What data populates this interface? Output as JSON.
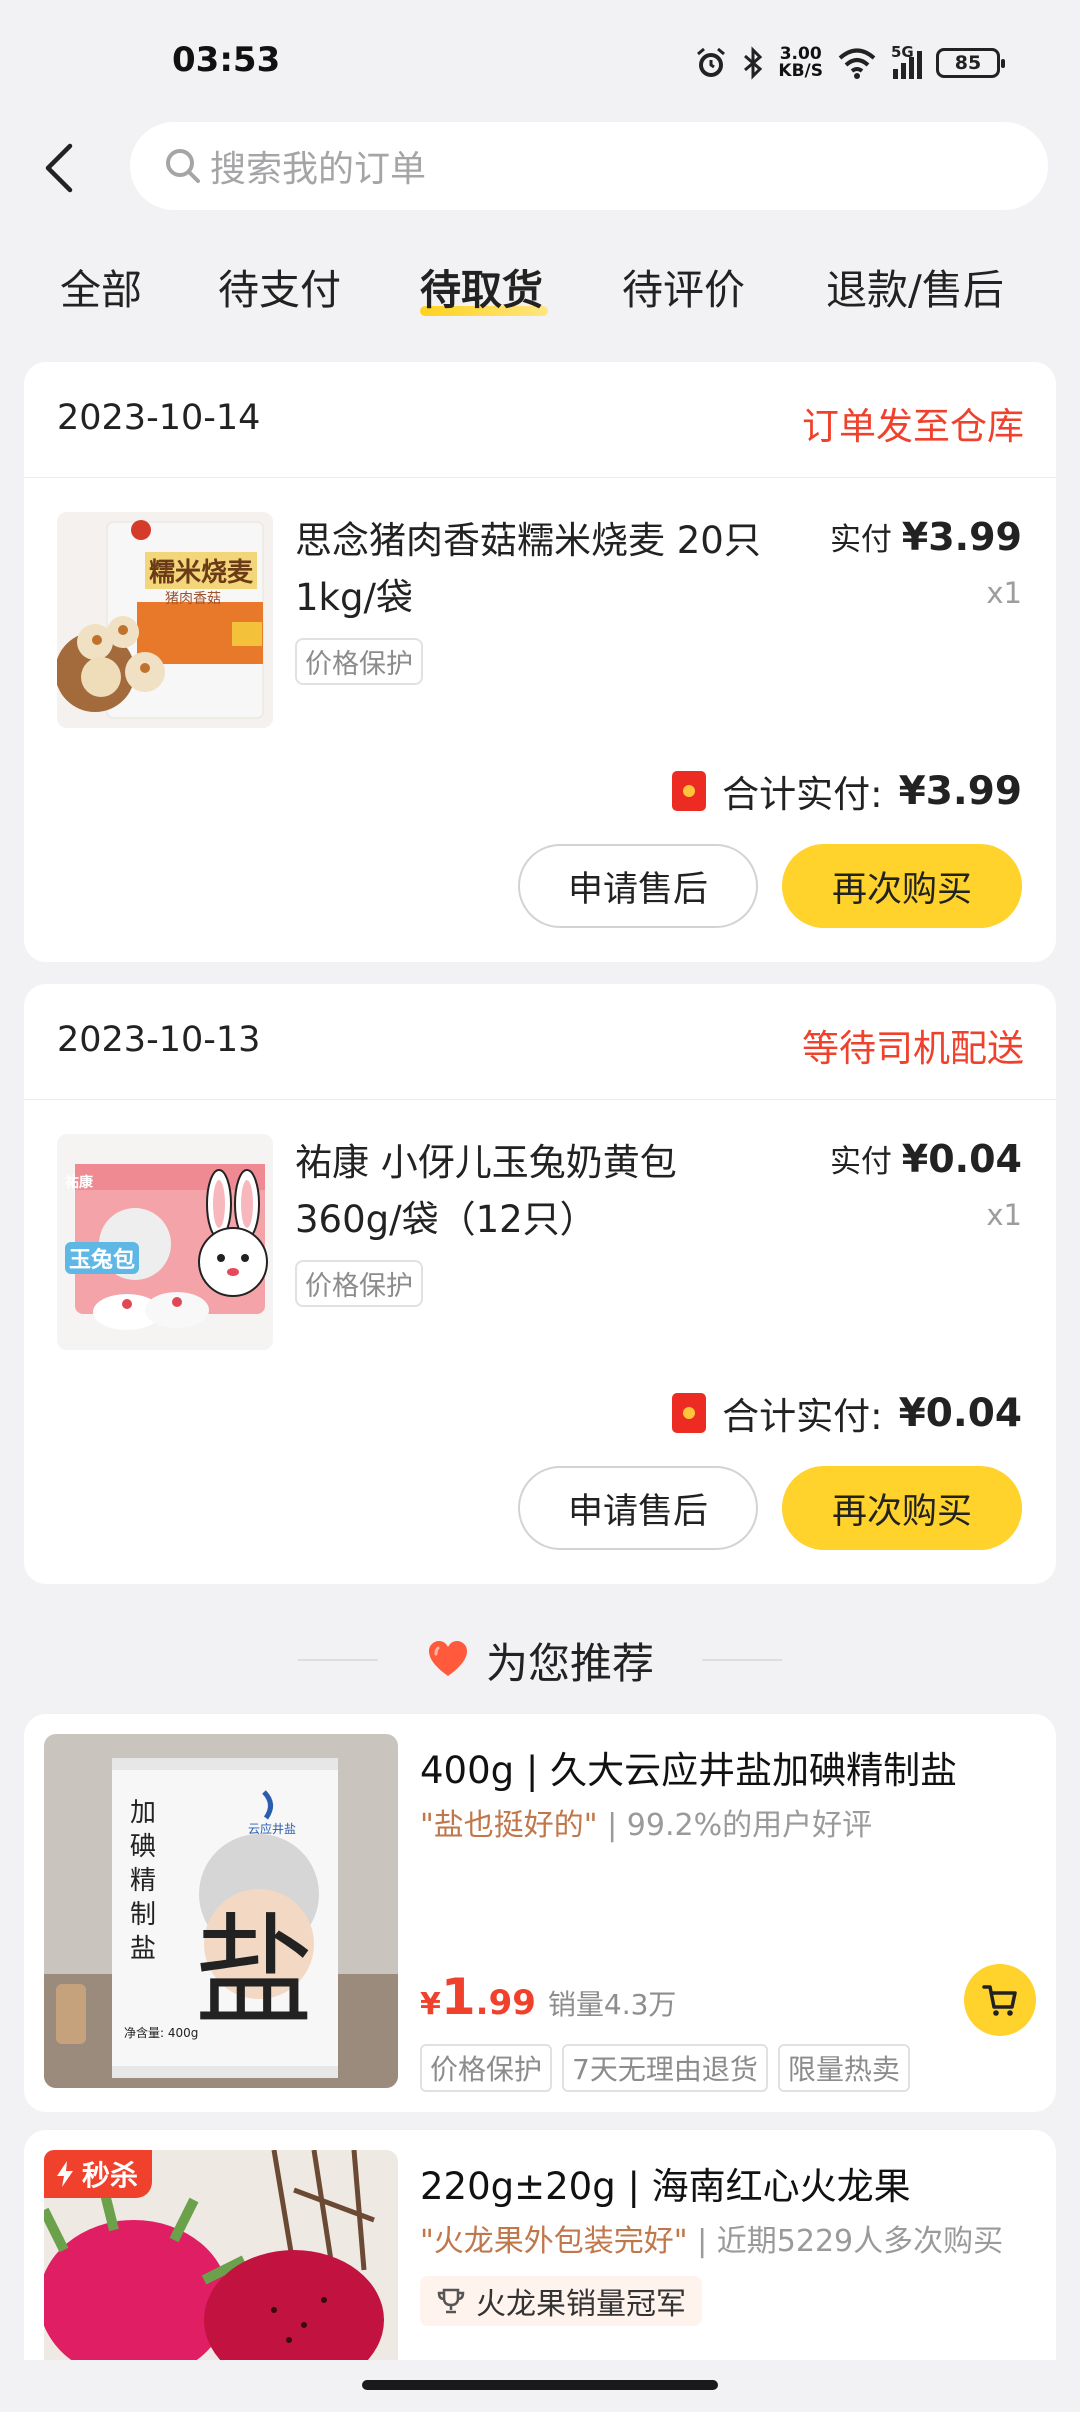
{
  "status_bar": {
    "time": "03:53",
    "speed_value": "3.00",
    "speed_unit": "KB/S",
    "network": "5G",
    "battery": "85",
    "icons": [
      "alarm-icon",
      "bluetooth-icon",
      "wifi-icon",
      "signal-icon",
      "battery-icon"
    ]
  },
  "header": {
    "search_placeholder": "搜索我的订单"
  },
  "tabs": [
    {
      "label": "全部",
      "active": false
    },
    {
      "label": "待支付",
      "active": false
    },
    {
      "label": "待取货",
      "active": true
    },
    {
      "label": "待评价",
      "active": false
    },
    {
      "label": "退款/售后",
      "active": false
    }
  ],
  "orders": [
    {
      "date": "2023-10-14",
      "status": "订单发至仓库",
      "product": {
        "name": "思念猪肉香菇糯米烧麦 20只 1kg/袋",
        "tag": "价格保护",
        "paid_label": "实付",
        "price": "¥3.99",
        "qty": "x1",
        "thumb_text": "糯米烧麦",
        "thumb_sub": "猪肉香菇"
      },
      "total_label": "合计实付:",
      "total": "¥3.99",
      "buttons": [
        "申请售后",
        "再次购买"
      ]
    },
    {
      "date": "2023-10-13",
      "status": "等待司机配送",
      "product": {
        "name": "祐康 小伢儿玉兔奶黄包 360g/袋（12只）",
        "tag": "价格保护",
        "paid_label": "实付",
        "price": "¥0.04",
        "qty": "x1",
        "thumb_text": "玉兔包",
        "thumb_sub": "祐康"
      },
      "total_label": "合计实付:",
      "total": "¥0.04",
      "buttons": [
        "申请售后",
        "再次购买"
      ]
    }
  ],
  "recommend": {
    "title": "为您推荐",
    "items": [
      {
        "name": "400g | 久大云应井盐加碘精制盐",
        "quote": "\"盐也挺好的\"",
        "quote_extra": "| 99.2%的用户好评",
        "currency": "¥",
        "price_int": "1",
        "price_dec": ".99",
        "sales": "销量4.3万",
        "tags": [
          "价格保护",
          "7天无理由退货",
          "限量热卖"
        ],
        "img_text": "加碘精制盐",
        "img_big": "盐",
        "img_brand": "云应井盐",
        "img_weight": "净含量: 400g"
      },
      {
        "badge": "秒杀",
        "name": "220g±20g | 海南红心火龙果",
        "quote": "\"火龙果外包装完好\"",
        "quote_extra": "| 近期5229人多次购买",
        "award": "火龙果销量冠军"
      }
    ]
  },
  "colors": {
    "accent_yellow": "#ffd22c",
    "status_red": "#f0412c",
    "background": "#f2f2f4"
  }
}
